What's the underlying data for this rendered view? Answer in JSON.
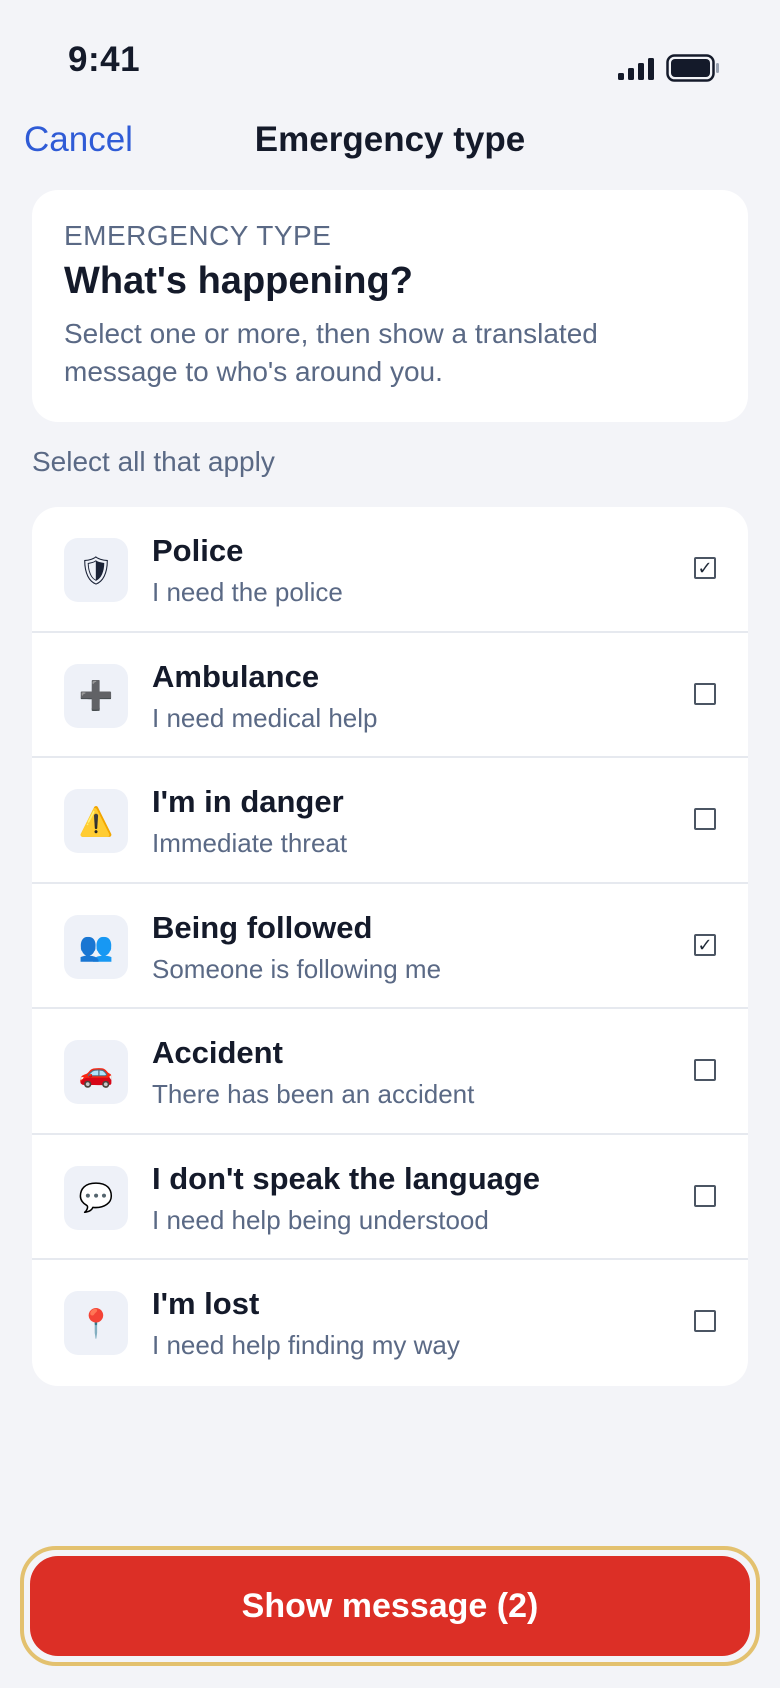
{
  "status_bar": {
    "time": "9:41"
  },
  "nav": {
    "cancel_label": "Cancel",
    "title": "Emergency type"
  },
  "intro": {
    "eyebrow": "EMERGENCY TYPE",
    "headline": "What's happening?",
    "text": "Select one or more, then show a translated message to who's around you."
  },
  "section_label": "Select all that apply",
  "options": [
    {
      "icon": "police-badge-icon",
      "glyph": "🛡",
      "title": "Police",
      "subtitle": "I need the police",
      "checked": true
    },
    {
      "icon": "plus-icon",
      "glyph": "➕",
      "title": "Ambulance",
      "subtitle": "I need medical help",
      "checked": false
    },
    {
      "icon": "warning-icon",
      "glyph": "⚠️",
      "title": "I'm in danger",
      "subtitle": "Immediate threat",
      "checked": false
    },
    {
      "icon": "people-icon",
      "glyph": "👥",
      "title": "Being followed",
      "subtitle": "Someone is following me",
      "checked": true
    },
    {
      "icon": "car-icon",
      "glyph": "🚗",
      "title": "Accident",
      "subtitle": "There has been an accident",
      "checked": false
    },
    {
      "icon": "speech-bubble-icon",
      "glyph": "💬",
      "title": "I don't speak the language",
      "subtitle": "I need help being understood",
      "checked": false
    },
    {
      "icon": "location-pin-icon",
      "glyph": "📍",
      "title": "I'm lost",
      "subtitle": "I need help finding my way",
      "checked": false
    }
  ],
  "cta": {
    "label": "Show message (2)"
  },
  "colors": {
    "accent": "#2f5bd6",
    "cta": "#dc2f26",
    "cta_outline": "#e3c16f",
    "background": "#f3f4f8"
  }
}
